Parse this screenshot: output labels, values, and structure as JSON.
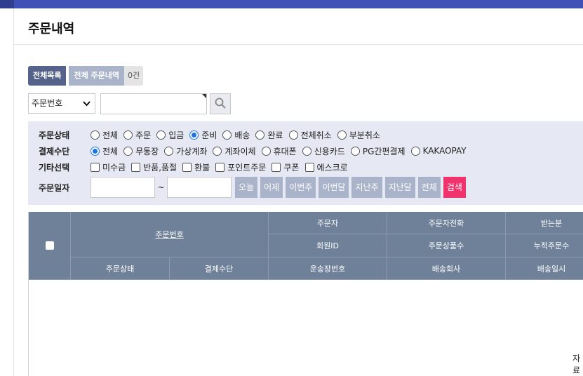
{
  "page": {
    "title": "주문내역"
  },
  "tabs": {
    "all_list": "전체목록",
    "all_orders": "전체 주문내역",
    "count": "0건"
  },
  "search": {
    "field_selected": "주문번호"
  },
  "filters": {
    "status": {
      "label": "주문상태",
      "options": [
        "전체",
        "주문",
        "입금",
        "준비",
        "배송",
        "완료",
        "전체취소",
        "부분취소"
      ],
      "selected": "준비"
    },
    "payment": {
      "label": "결제수단",
      "options": [
        "전체",
        "무통장",
        "가상계좌",
        "계좌이체",
        "휴대폰",
        "신용카드",
        "PG간편결제",
        "KAKAOPAY"
      ],
      "selected": "전체"
    },
    "etc": {
      "label": "기타선택",
      "options": [
        "미수금",
        "반품,품절",
        "환불",
        "포인트주문",
        "쿠폰",
        "에스크로"
      ]
    },
    "date": {
      "label": "주문일자",
      "separator": "~",
      "quick": [
        "오늘",
        "어제",
        "이번주",
        "이번달",
        "지난주",
        "지난달",
        "전체"
      ],
      "search_label": "검색"
    }
  },
  "grid": {
    "headers": {
      "order_no": "주문번호",
      "orderer": "주문자",
      "orderer_phone": "주문자전화",
      "receiver": "받는분",
      "member_id": "회원ID",
      "product_count": "주문상품수",
      "cumulative": "누적주문수",
      "order_status": "주문상태",
      "payment_method": "결제수단",
      "tracking_no": "운송장번호",
      "courier": "배송회사",
      "ship_date": "배송일시"
    },
    "empty_text_fragment": "자료"
  },
  "colors": {
    "accent": "#3f51b5",
    "header_bg": "#6f8199",
    "search_btn": "#f0336d",
    "tab_active": "#55628a"
  }
}
